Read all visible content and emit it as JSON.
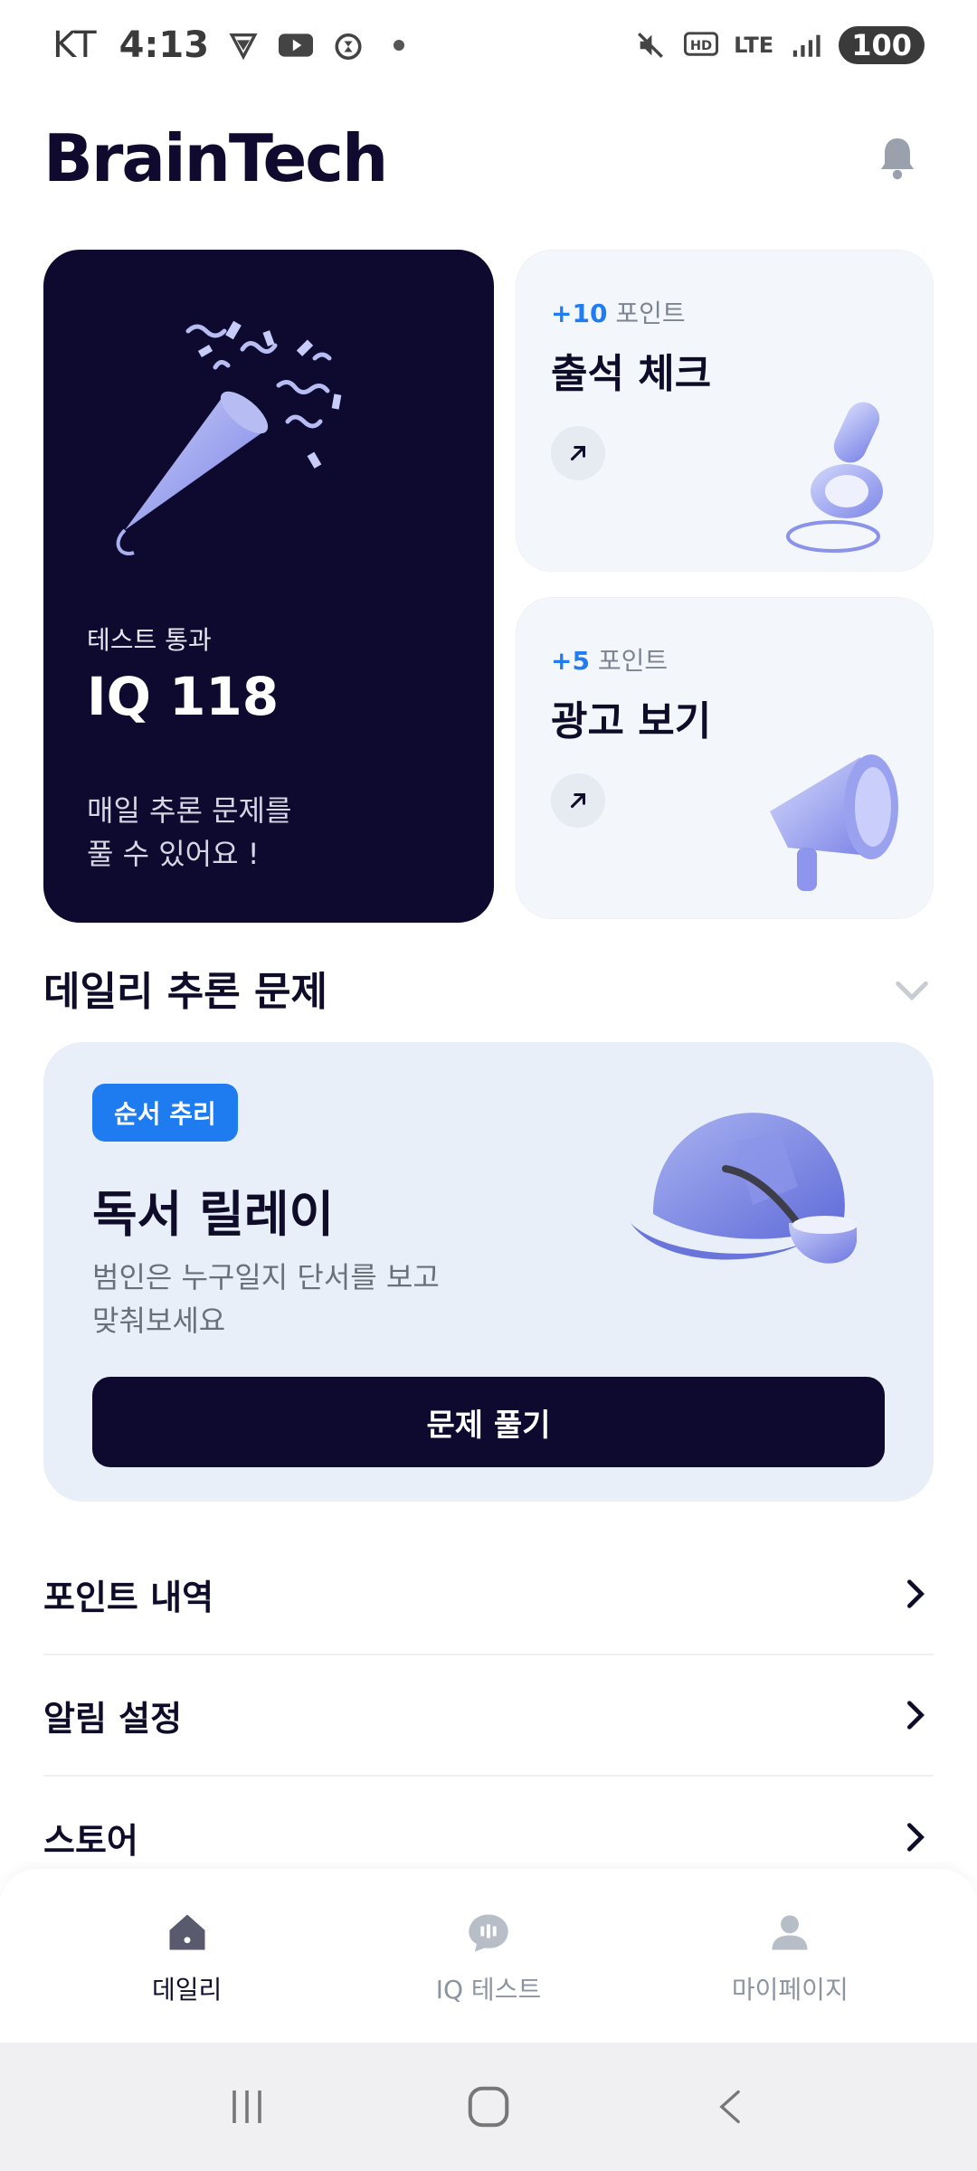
{
  "status_bar": {
    "carrier": "KT",
    "time": "4:13",
    "network": "LTE",
    "battery": "100"
  },
  "header": {
    "logo": "BrainTech"
  },
  "iq_card": {
    "subtitle": "테스트 통과",
    "score": "IQ 118",
    "desc_line1": "매일 추론 문제를",
    "desc_line2": "풀 수 있어요 !"
  },
  "cards": [
    {
      "points_plus": "+10",
      "points_label": "포인트",
      "title": "출석 체크",
      "icon": "stamp-icon"
    },
    {
      "points_plus": "+5",
      "points_label": "포인트",
      "title": "광고 보기",
      "icon": "megaphone-icon"
    }
  ],
  "daily": {
    "section_title": "데일리 추론 문제",
    "badge": "순서 추리",
    "title": "독서 릴레이",
    "desc_line1": "범인은 누구일지 단서를 보고",
    "desc_line2": "맞춰보세요",
    "button": "문제 풀기"
  },
  "menu": [
    {
      "label": "포인트 내역"
    },
    {
      "label": "알림 설정"
    },
    {
      "label": "스토어"
    }
  ],
  "bottom_nav": [
    {
      "label": "데일리",
      "icon": "home-icon",
      "active": true
    },
    {
      "label": "IQ 테스트",
      "icon": "chat-bubble-icon",
      "active": false
    },
    {
      "label": "마이페이지",
      "icon": "person-icon",
      "active": false
    }
  ],
  "colors": {
    "primary_dark": "#0e0a2f",
    "accent_blue": "#1e7bf0",
    "card_bg": "#f3f6fb",
    "daily_bg": "#e9eff8"
  }
}
